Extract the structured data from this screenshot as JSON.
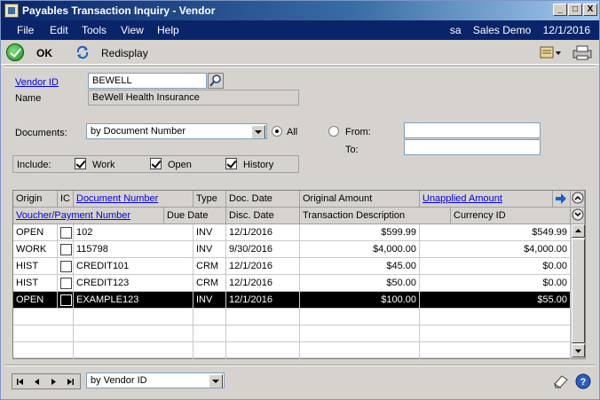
{
  "window": {
    "title": "Payables Transaction Inquiry - Vendor",
    "controls": {
      "minimize": "_",
      "maximize": "□",
      "close": "X"
    }
  },
  "menubar": {
    "items": [
      "File",
      "Edit",
      "Tools",
      "View",
      "Help"
    ],
    "user": "sa",
    "company": "Sales Demo",
    "date": "12/1/2016"
  },
  "toolbar": {
    "ok_label": "OK",
    "redisplay_label": "Redisplay"
  },
  "vendor": {
    "id_label": "Vendor ID",
    "id_value": "BEWELL",
    "name_label": "Name",
    "name_value": "BeWell Health Insurance"
  },
  "documents": {
    "label": "Documents:",
    "sort_value": "by Document Number",
    "all_label": "All",
    "from_label": "From:",
    "to_label": "To:",
    "from_value": "",
    "to_value": "",
    "all_selected": true
  },
  "include": {
    "label": "Include:",
    "work_label": "Work",
    "open_label": "Open",
    "history_label": "History",
    "work_checked": true,
    "open_checked": true,
    "history_checked": true
  },
  "grid": {
    "headers_row1": {
      "origin": "Origin",
      "ic": "IC",
      "document_number": "Document Number",
      "type": "Type",
      "doc_date": "Doc. Date",
      "original_amount": "Original Amount",
      "unapplied_amount": "Unapplied Amount"
    },
    "headers_row2": {
      "voucher_payment_number": "Voucher/Payment Number",
      "due_date": "Due Date",
      "disc_date": "Disc. Date",
      "transaction_description": "Transaction Description",
      "currency_id": "Currency ID"
    },
    "rows": [
      {
        "origin": "OPEN",
        "doc": "102",
        "type": "INV",
        "date": "12/1/2016",
        "original": "$599.99",
        "unapplied": "$549.99"
      },
      {
        "origin": "WORK",
        "doc": "115798",
        "type": "INV",
        "date": "9/30/2016",
        "original": "$4,000.00",
        "unapplied": "$4,000.00"
      },
      {
        "origin": "HIST",
        "doc": "CREDIT101",
        "type": "CRM",
        "date": "12/1/2016",
        "original": "$45.00",
        "unapplied": "$0.00"
      },
      {
        "origin": "HIST",
        "doc": "CREDIT123",
        "type": "CRM",
        "date": "12/1/2016",
        "original": "$50.00",
        "unapplied": "$0.00"
      },
      {
        "origin": "OPEN",
        "doc": "EXAMPLE123",
        "type": "INV",
        "date": "12/1/2016",
        "original": "$100.00",
        "unapplied": "$55.00"
      }
    ],
    "selected_row": 4
  },
  "bottom": {
    "sort_value": "by Vendor ID"
  },
  "icons": {
    "ok": "ok-checkmark-icon",
    "redisplay": "redisplay-icon",
    "lookup": "magnifier-icon",
    "note": "note-icon",
    "help": "help-icon"
  }
}
